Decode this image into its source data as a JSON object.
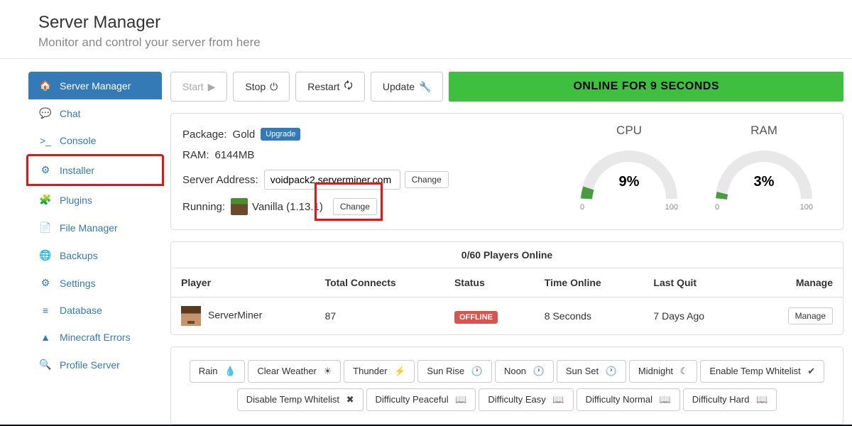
{
  "header": {
    "title": "Server Manager",
    "subtitle": "Monitor and control your server from here"
  },
  "sidebar": {
    "items": [
      {
        "icon": "home",
        "label": "Server Manager",
        "active": true
      },
      {
        "icon": "chat",
        "label": "Chat"
      },
      {
        "icon": "console",
        "label": "Console"
      },
      {
        "icon": "installer",
        "label": "Installer",
        "highlight": true
      },
      {
        "icon": "plugins",
        "label": "Plugins"
      },
      {
        "icon": "file",
        "label": "File Manager"
      },
      {
        "icon": "backup",
        "label": "Backups"
      },
      {
        "icon": "settings",
        "label": "Settings"
      },
      {
        "icon": "database",
        "label": "Database"
      },
      {
        "icon": "error",
        "label": "Minecraft Errors"
      },
      {
        "icon": "search",
        "label": "Profile Server"
      }
    ]
  },
  "toolbar": {
    "start": "Start",
    "stop": "Stop",
    "restart": "Restart",
    "update": "Update",
    "status": "ONLINE FOR 9 SECONDS"
  },
  "info": {
    "package_label": "Package:",
    "package_value": "Gold",
    "upgrade": "Upgrade",
    "ram_label": "RAM:",
    "ram_value": "6144MB",
    "addr_label": "Server Address:",
    "addr_value": "voidpack2.serverminer.com",
    "change": "Change",
    "running_label": "Running:",
    "running_value": "Vanilla (1.13.1)"
  },
  "gauges": {
    "cpu": {
      "title": "CPU",
      "value": "9%",
      "pct": 9,
      "min": "0",
      "max": "100"
    },
    "ram": {
      "title": "RAM",
      "value": "3%",
      "pct": 3,
      "min": "0",
      "max": "100"
    }
  },
  "players": {
    "header": "0/60 Players Online",
    "cols": {
      "player": "Player",
      "connects": "Total Connects",
      "status": "Status",
      "time": "Time Online",
      "quit": "Last Quit",
      "manage": "Manage"
    },
    "rows": [
      {
        "name": "ServerMiner",
        "connects": "87",
        "status": "OFFLINE",
        "time": "8 Seconds",
        "quit": "7 Days Ago",
        "manage": "Manage"
      }
    ]
  },
  "actions": [
    {
      "label": "Rain",
      "icon": "💧"
    },
    {
      "label": "Clear Weather",
      "icon": "☀"
    },
    {
      "label": "Thunder",
      "icon": "⚡"
    },
    {
      "label": "Sun Rise",
      "icon": "🕐"
    },
    {
      "label": "Noon",
      "icon": "🕐"
    },
    {
      "label": "Sun Set",
      "icon": "🕐"
    },
    {
      "label": "Midnight",
      "icon": "☾"
    },
    {
      "label": "Enable Temp Whitelist",
      "icon": "✔"
    },
    {
      "label": "Disable Temp Whitelist",
      "icon": "✖"
    },
    {
      "label": "Difficulty Peaceful",
      "icon": "📖"
    },
    {
      "label": "Difficulty Easy",
      "icon": "📖"
    },
    {
      "label": "Difficulty Normal",
      "icon": "📖"
    },
    {
      "label": "Difficulty Hard",
      "icon": "📖"
    }
  ],
  "icons": {
    "home": "🏠",
    "chat": "💬",
    "console": ">_",
    "installer": "⚙",
    "plugins": "🧩",
    "file": "📄",
    "backup": "🌐",
    "settings": "⚙",
    "database": "≡",
    "error": "▲",
    "search": "🔍",
    "play": "▶",
    "power": "⏻",
    "refresh": "🗘",
    "wrench": "🔧"
  }
}
